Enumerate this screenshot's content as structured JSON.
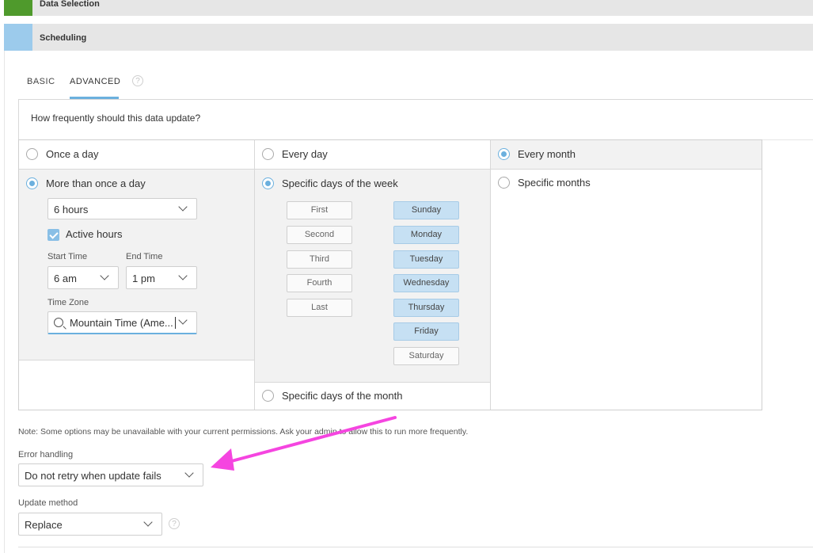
{
  "sections": {
    "data_selection": {
      "title": "Data Selection",
      "color": "#4f9a2c"
    },
    "scheduling": {
      "title": "Scheduling",
      "color": "#9ccbec"
    }
  },
  "tabs": [
    {
      "label": "BASIC",
      "active": false
    },
    {
      "label": "ADVANCED",
      "active": true
    }
  ],
  "question": "How frequently should this data update?",
  "daily": {
    "once_label": "Once a day",
    "more_label": "More than once a day",
    "interval_value": "6 hours",
    "active_hours_label": "Active hours",
    "active_hours_checked": true,
    "start_time_label": "Start Time",
    "start_time_value": "6 am",
    "end_time_label": "End Time",
    "end_time_value": "1 pm",
    "timezone_label": "Time Zone",
    "timezone_value": "Mountain Time (Ame..."
  },
  "weekly": {
    "every_day_label": "Every day",
    "specific_week_label": "Specific days of the week",
    "week_ordinals": [
      "First",
      "Second",
      "Third",
      "Fourth",
      "Last"
    ],
    "weekdays": [
      {
        "label": "Sunday",
        "selected": true
      },
      {
        "label": "Monday",
        "selected": true
      },
      {
        "label": "Tuesday",
        "selected": true
      },
      {
        "label": "Wednesday",
        "selected": true
      },
      {
        "label": "Thursday",
        "selected": true
      },
      {
        "label": "Friday",
        "selected": true
      },
      {
        "label": "Saturday",
        "selected": false
      }
    ],
    "specific_month_days_label": "Specific days of the month"
  },
  "monthly": {
    "every_month_label": "Every month",
    "specific_months_label": "Specific months"
  },
  "note": "Note: Some options may be unavailable with your current permissions. Ask your admin to allow this to run more frequently.",
  "error_handling": {
    "label": "Error handling",
    "value": "Do not retry when update fails"
  },
  "update_method": {
    "label": "Update method",
    "value": "Replace"
  },
  "colors": {
    "accent": "#6bb0de",
    "arrow": "#f545e0",
    "day_selected": "#c6e0f3"
  }
}
